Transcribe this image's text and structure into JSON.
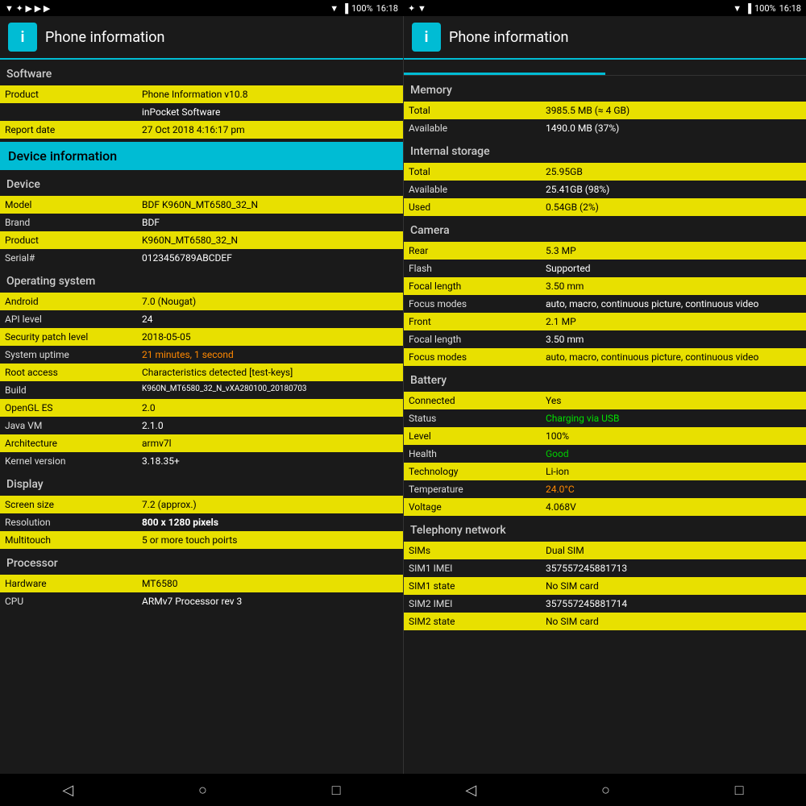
{
  "statusBar": {
    "battery": "100%",
    "time": "16:18"
  },
  "app": {
    "title": "Phone information",
    "icon": "i"
  },
  "leftPane": {
    "tabs": [
      {
        "label": "Software",
        "active": true
      },
      {
        "label": "Device",
        "active": false
      }
    ],
    "software": {
      "label": "Software",
      "rows": [
        {
          "key": "Product",
          "value": "Phone Information v10.8",
          "highlight": "yellow"
        },
        {
          "key": "",
          "value": "inPocket Software",
          "highlight": "normal"
        },
        {
          "key": "Report date",
          "value": "27 Oct 2018 4:16:17 pm",
          "highlight": "yellow"
        }
      ]
    },
    "deviceInfoHeader": "Device information",
    "device": {
      "label": "Device",
      "rows": [
        {
          "key": "Model",
          "value": "BDF K960N_MT6580_32_N",
          "highlight": "yellow"
        },
        {
          "key": "Brand",
          "value": "BDF",
          "highlight": "normal"
        },
        {
          "key": "Product",
          "value": "K960N_MT6580_32_N",
          "highlight": "yellow"
        },
        {
          "key": "Serial#",
          "value": "0123456789ABCDEF",
          "highlight": "normal"
        }
      ]
    },
    "os": {
      "label": "Operating system",
      "rows": [
        {
          "key": "Android",
          "value": "7.0 (Nougat)",
          "highlight": "yellow"
        },
        {
          "key": "API level",
          "value": "24",
          "highlight": "normal"
        },
        {
          "key": "Security patch level",
          "value": "2018-05-05",
          "highlight": "yellow"
        },
        {
          "key": "System uptime",
          "value": "21 minutes, 1 second",
          "highlight": "orange"
        },
        {
          "key": "Root access",
          "value": "Characteristics detected [test-keys]",
          "highlight": "yellow"
        },
        {
          "key": "Build",
          "value": "K960N_MT6580_32_N_vXA280100_20180703",
          "highlight": "normal"
        },
        {
          "key": "OpenGL ES",
          "value": "2.0",
          "highlight": "yellow"
        },
        {
          "key": "Java VM",
          "value": "2.1.0",
          "highlight": "normal"
        },
        {
          "key": "Architecture",
          "value": "armv7l",
          "highlight": "yellow"
        },
        {
          "key": "Kernel version",
          "value": "3.18.35+",
          "highlight": "normal"
        }
      ]
    },
    "display": {
      "label": "Display",
      "rows": [
        {
          "key": "Screen size",
          "value": "7.2 (approx.)",
          "highlight": "yellow"
        },
        {
          "key": "Resolution",
          "value": "800 x 1280 pixels",
          "highlight": "normal"
        },
        {
          "key": "Multitouch",
          "value": "5 or more touch poirts",
          "highlight": "yellow"
        }
      ]
    },
    "processor": {
      "label": "Processor",
      "rows": [
        {
          "key": "Hardware",
          "value": "MT6580",
          "highlight": "yellow"
        },
        {
          "key": "CPU",
          "value": "ARMv7 Processor rev 3",
          "highlight": "normal"
        }
      ]
    }
  },
  "rightPane": {
    "memory": {
      "label": "Memory",
      "rows": [
        {
          "key": "Total",
          "value": "3985.5 MB (≈ 4 GB)",
          "highlight": "yellow"
        },
        {
          "key": "Available",
          "value": "1490.0 MB (37%)",
          "highlight": "normal"
        }
      ]
    },
    "internalStorage": {
      "label": "Internal storage",
      "rows": [
        {
          "key": "Total",
          "value": "25.95GB",
          "highlight": "yellow"
        },
        {
          "key": "Available",
          "value": "25.41GB (98%)",
          "highlight": "normal"
        },
        {
          "key": "Used",
          "value": "0.54GB (2%)",
          "highlight": "yellow"
        }
      ]
    },
    "camera": {
      "label": "Camera",
      "rows": [
        {
          "key": "Rear",
          "value": "5.3 MP",
          "highlight": "yellow"
        },
        {
          "key": "Flash",
          "value": "Supported",
          "highlight": "normal"
        },
        {
          "key": "Focal length",
          "value": "3.50 mm",
          "highlight": "yellow"
        },
        {
          "key": "Focus modes",
          "value": "auto, macro, continuous picture, continuous video",
          "highlight": "normal"
        },
        {
          "key": "Front",
          "value": "2.1 MP",
          "highlight": "yellow"
        },
        {
          "key": "Focal length",
          "value": "3.50 mm",
          "highlight": "normal"
        },
        {
          "key": "Focus modes",
          "value": "auto, macro, continuous picture, continuous video",
          "highlight": "yellow"
        }
      ]
    },
    "battery": {
      "label": "Battery",
      "rows": [
        {
          "key": "Connected",
          "value": "Yes",
          "highlight": "yellow"
        },
        {
          "key": "Status",
          "value": "Charging via USB",
          "highlight": "green"
        },
        {
          "key": "Level",
          "value": "100%",
          "highlight": "green-text"
        },
        {
          "key": "Health",
          "value": "Good",
          "highlight": "green-text"
        },
        {
          "key": "Technology",
          "value": "Li-ion",
          "highlight": "yellow"
        },
        {
          "key": "Temperature",
          "value": "24.0°C",
          "highlight": "orange-text"
        },
        {
          "key": "Voltage",
          "value": "4.068V",
          "highlight": "yellow"
        }
      ]
    },
    "telephony": {
      "label": "Telephony network",
      "rows": [
        {
          "key": "SIMs",
          "value": "Dual SIM",
          "highlight": "yellow"
        },
        {
          "key": "SIM1 IMEI",
          "value": "357557245881713",
          "highlight": "normal"
        },
        {
          "key": "SIM1 state",
          "value": "No SIM card",
          "highlight": "red"
        },
        {
          "key": "SIM2 IMEI",
          "value": "357557245881714",
          "highlight": "yellow"
        },
        {
          "key": "SIM2 state",
          "value": "No SIM card",
          "highlight": "red"
        }
      ]
    }
  }
}
